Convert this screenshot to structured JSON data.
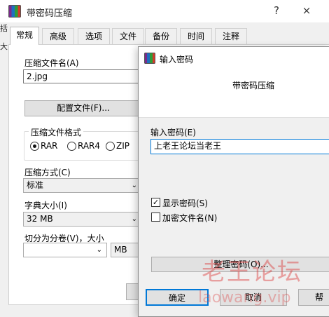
{
  "main": {
    "title": "带密码压缩",
    "title_buttons": {
      "help": "?",
      "close": "×"
    },
    "side_fragment": "括",
    "side_fragment2": "大",
    "tabs": [
      {
        "label": "常规",
        "active": true
      },
      {
        "label": "高级"
      },
      {
        "label": "选项"
      },
      {
        "label": "文件"
      },
      {
        "label": "备份"
      },
      {
        "label": "时间"
      },
      {
        "label": "注释"
      }
    ],
    "archive_name_label": "压缩文件名(A)",
    "archive_name_value": "2.jpg",
    "profiles_button": "配置文件(F)...",
    "format_group_label": "压缩文件格式",
    "formats": [
      {
        "label": "RAR",
        "selected": true
      },
      {
        "label": "RAR4",
        "selected": false
      },
      {
        "label": "ZIP",
        "selected": false
      }
    ],
    "method_label": "压缩方式(C)",
    "method_value": "标准",
    "dict_label": "字典大小(I)",
    "dict_value": "32 MB",
    "split_label": "切分为分卷(V)，大小",
    "split_unit": "MB"
  },
  "dialog": {
    "title": "输入密码",
    "header": "带密码压缩",
    "password_label": "输入密码(E)",
    "password_value": "上老王论坛当老王",
    "show_password_label": "显示密码(S)",
    "show_password_checked": true,
    "encrypt_names_label": "加密文件名(N)",
    "encrypt_names_checked": false,
    "organize_button": "整理密码(O)...",
    "ok_button": "确定",
    "cancel_button": "取消",
    "help_button": "帮"
  },
  "watermark": {
    "text": "老王论坛",
    "url": "laowang.vip"
  },
  "colors": {
    "dialog_border": "#8a8a8a",
    "ok_border": "#0078d7",
    "watermark": "#dc3c3c"
  }
}
